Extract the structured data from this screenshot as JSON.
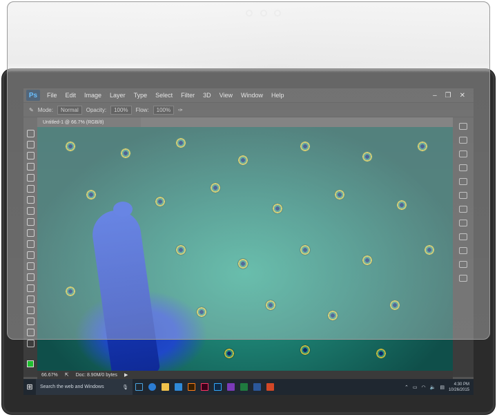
{
  "photoshop": {
    "logo": "Ps",
    "menu": [
      "File",
      "Edit",
      "Image",
      "Layer",
      "Type",
      "Select",
      "Filter",
      "3D",
      "View",
      "Window",
      "Help"
    ],
    "window_controls": [
      "–",
      "❐",
      "✕"
    ],
    "options": {
      "mode_label": "Mode:",
      "mode_value": "Normal",
      "opacity_label": "Opacity:",
      "opacity_value": "100%",
      "flow_label": "Flow:",
      "flow_value": "100%"
    },
    "document_tab": "Untitled-1 @ 66.7% (RGB/8)",
    "status": {
      "zoom": "66.67%",
      "doc": "Doc: 8.90M/0 bytes"
    },
    "foreground_color": "#1fbf2f"
  },
  "taskbar": {
    "search_placeholder": "Search the web and Windows",
    "time": "4:30 PM",
    "date": "10/26/2015",
    "apps": [
      {
        "name": "task-view-icon",
        "color": "#4aa3df"
      },
      {
        "name": "edge-icon",
        "color": "#2b7cd3"
      },
      {
        "name": "file-explorer-icon",
        "color": "#f0c24b"
      },
      {
        "name": "store-icon",
        "color": "#2f8ad8"
      },
      {
        "name": "illustrator-icon",
        "color": "#ff7f18"
      },
      {
        "name": "indesign-icon",
        "color": "#ff3366"
      },
      {
        "name": "photoshop-icon",
        "color": "#31a8ff"
      },
      {
        "name": "onenote-icon",
        "color": "#7b3ab8"
      },
      {
        "name": "excel-icon",
        "color": "#1f7a3f"
      },
      {
        "name": "word-icon",
        "color": "#2b579a"
      },
      {
        "name": "powerpoint-icon",
        "color": "#d24726"
      }
    ]
  }
}
